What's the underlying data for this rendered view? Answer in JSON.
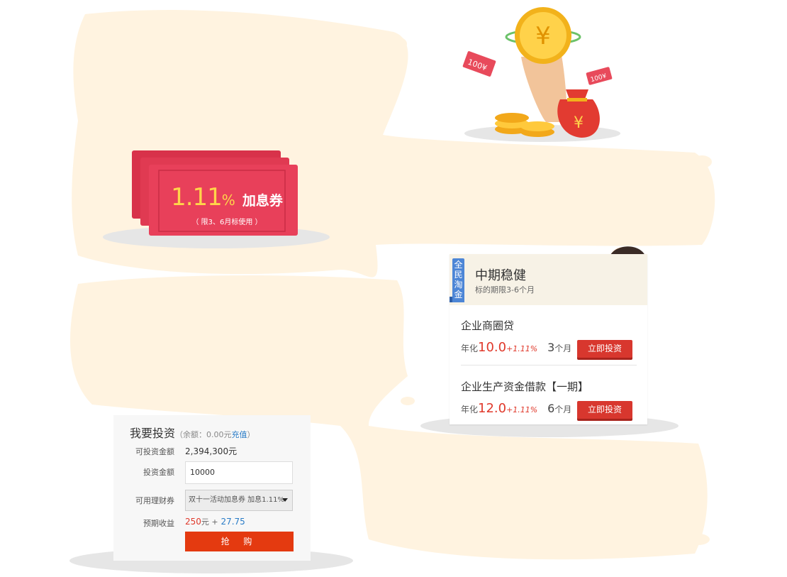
{
  "coupon": {
    "rate": "1.11",
    "rate_unit": "%",
    "type": "加息券",
    "limit": "（ 限3、6月标使用 ）"
  },
  "product_card": {
    "ribbon": "全民淘金",
    "title": "中期稳健",
    "subtitle": "标的期限3-6个月",
    "products": [
      {
        "name": "企业商圈贷",
        "rate_prefix": "年化",
        "rate": "10.0",
        "bonus": "+1.11%",
        "term": "3",
        "term_unit": "个月",
        "button": "立即投资"
      },
      {
        "name": "企业生产资金借款【一期】",
        "rate_prefix": "年化",
        "rate": "12.0",
        "bonus": "+1.11%",
        "term": "6",
        "term_unit": "个月",
        "button": "立即投资"
      }
    ]
  },
  "invest_panel": {
    "title": "我要投资",
    "balance_open": "（余额：",
    "balance": "0.00元",
    "recharge": "充值",
    "balance_close": "）",
    "available_label": "可投资金额",
    "available_value": "2,394,300元",
    "amount_label": "投资金额",
    "amount_value": "10000",
    "coupon_label": "可用理财券",
    "coupon_selected": "双十一活动加息券 加息1.11%",
    "earnings_label": "预期收益",
    "earnings_base": "250",
    "earnings_base_unit": "元 +",
    "earnings_bonus": "27.75",
    "buy_button": "抢 购"
  },
  "colors": {
    "blob": "#fff3e0",
    "accent_red": "#d8372e",
    "buy_orange": "#e43a10",
    "link_blue": "#2a7cc7"
  }
}
